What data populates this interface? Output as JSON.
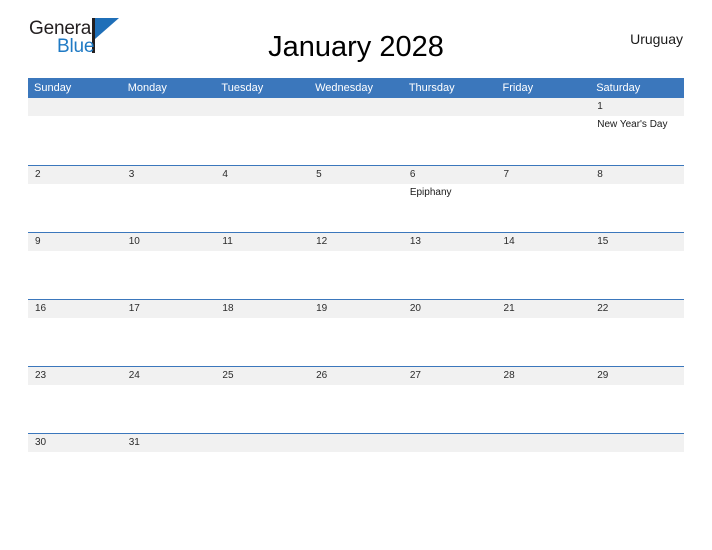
{
  "header": {
    "logo": {
      "text_primary": "General",
      "text_secondary": "Blue",
      "icon": "flag-triangle-icon",
      "color_primary": "#231f20",
      "color_secondary": "#1f7ac4",
      "color_flag": "#1f6fb8"
    },
    "title": "January 2028",
    "country": "Uruguay"
  },
  "calendar": {
    "month": "January",
    "year": "2028",
    "accent_color": "#3b77bc",
    "date_band_color": "#f1f1f1",
    "weekday_headers": [
      "Sunday",
      "Monday",
      "Tuesday",
      "Wednesday",
      "Thursday",
      "Friday",
      "Saturday"
    ],
    "weeks": [
      [
        {
          "day": "",
          "event": ""
        },
        {
          "day": "",
          "event": ""
        },
        {
          "day": "",
          "event": ""
        },
        {
          "day": "",
          "event": ""
        },
        {
          "day": "",
          "event": ""
        },
        {
          "day": "",
          "event": ""
        },
        {
          "day": "1",
          "event": "New Year's Day"
        }
      ],
      [
        {
          "day": "2",
          "event": ""
        },
        {
          "day": "3",
          "event": ""
        },
        {
          "day": "4",
          "event": ""
        },
        {
          "day": "5",
          "event": ""
        },
        {
          "day": "6",
          "event": "Epiphany"
        },
        {
          "day": "7",
          "event": ""
        },
        {
          "day": "8",
          "event": ""
        }
      ],
      [
        {
          "day": "9",
          "event": ""
        },
        {
          "day": "10",
          "event": ""
        },
        {
          "day": "11",
          "event": ""
        },
        {
          "day": "12",
          "event": ""
        },
        {
          "day": "13",
          "event": ""
        },
        {
          "day": "14",
          "event": ""
        },
        {
          "day": "15",
          "event": ""
        }
      ],
      [
        {
          "day": "16",
          "event": ""
        },
        {
          "day": "17",
          "event": ""
        },
        {
          "day": "18",
          "event": ""
        },
        {
          "day": "19",
          "event": ""
        },
        {
          "day": "20",
          "event": ""
        },
        {
          "day": "21",
          "event": ""
        },
        {
          "day": "22",
          "event": ""
        }
      ],
      [
        {
          "day": "23",
          "event": ""
        },
        {
          "day": "24",
          "event": ""
        },
        {
          "day": "25",
          "event": ""
        },
        {
          "day": "26",
          "event": ""
        },
        {
          "day": "27",
          "event": ""
        },
        {
          "day": "28",
          "event": ""
        },
        {
          "day": "29",
          "event": ""
        }
      ],
      [
        {
          "day": "30",
          "event": ""
        },
        {
          "day": "31",
          "event": ""
        },
        {
          "day": "",
          "event": ""
        },
        {
          "day": "",
          "event": ""
        },
        {
          "day": "",
          "event": ""
        },
        {
          "day": "",
          "event": ""
        },
        {
          "day": "",
          "event": ""
        }
      ]
    ]
  }
}
